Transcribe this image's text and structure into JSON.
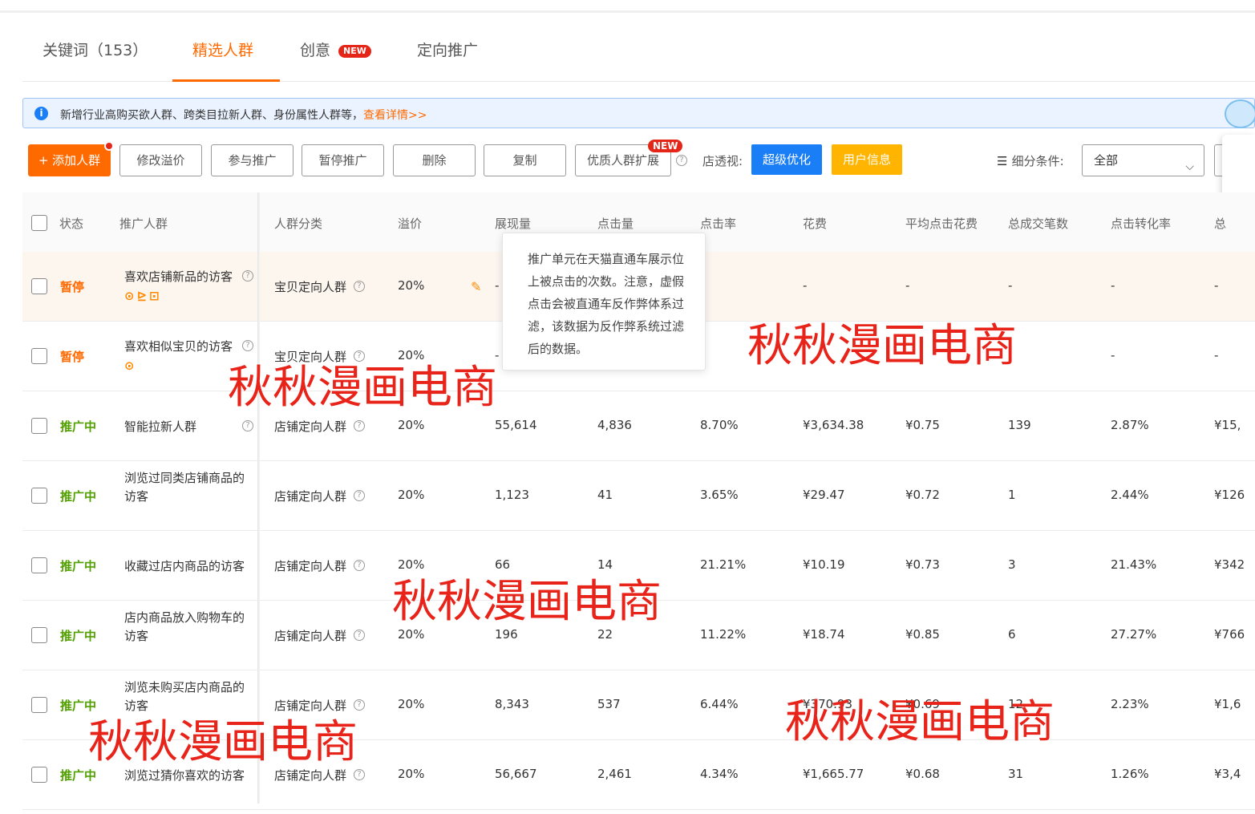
{
  "tabs": [
    {
      "label": "关键词（153）",
      "active": false
    },
    {
      "label": "精选人群",
      "active": true
    },
    {
      "label": "创意",
      "badge": "NEW",
      "active": false
    },
    {
      "label": "定向推广",
      "active": false
    }
  ],
  "notice": {
    "text": "新增行业高购买欲人群、跨类目拉新人群、身份属性人群等，",
    "link": "查看详情>>"
  },
  "toolbar": {
    "add": "+ 添加人群",
    "modify_premium": "修改溢价",
    "join": "参与推广",
    "pause": "暂停推广",
    "delete": "删除",
    "copy": "复制",
    "quality_expand": "优质人群扩展",
    "quality_badge": "NEW",
    "shop_view_label": "店透视:",
    "super_optimize": "超级优化",
    "user_info": "用户信息",
    "filter_label": "细分条件:",
    "filter_value": "全部"
  },
  "table": {
    "headers": [
      "状态",
      "推广人群",
      "人群分类",
      "溢价",
      "展现量",
      "点击量",
      "点击率",
      "花费",
      "平均点击花费",
      "总成交笔数",
      "点击转化率",
      "总"
    ],
    "rows": [
      {
        "status": "暂停",
        "status_type": "paused",
        "name1": "喜欢店铺新品的访客",
        "name2": "",
        "help": true,
        "icons": "⊙⊵⊡",
        "category": "宝贝定向人群",
        "premium": "20%",
        "impressions": "-",
        "clicks": "",
        "ctr": "",
        "cost": "-",
        "cpc": "-",
        "orders": "-",
        "cvr": "-",
        "total": "-"
      },
      {
        "status": "暂停",
        "status_type": "paused",
        "name1": "喜欢相似宝贝的访客",
        "name2": "",
        "help": true,
        "icons": "⊙",
        "category": "宝贝定向人群",
        "premium": "20%",
        "impressions": "-",
        "clicks": "",
        "ctr": "",
        "cost": "",
        "cpc": "",
        "orders": "",
        "cvr": "-",
        "total": "-"
      },
      {
        "status": "推广中",
        "status_type": "active",
        "name1": "智能拉新人群",
        "name2": "",
        "help": true,
        "icons": "",
        "category": "店铺定向人群",
        "premium": "20%",
        "impressions": "55,614",
        "clicks": "4,836",
        "ctr": "8.70%",
        "cost": "¥3,634.38",
        "cpc": "¥0.75",
        "orders": "139",
        "cvr": "2.87%",
        "total": "¥15,"
      },
      {
        "status": "推广中",
        "status_type": "active",
        "name1": "浏览过同类店铺商品的",
        "name2": "访客",
        "help": false,
        "icons": "",
        "category": "店铺定向人群",
        "premium": "20%",
        "impressions": "1,123",
        "clicks": "41",
        "ctr": "3.65%",
        "cost": "¥29.47",
        "cpc": "¥0.72",
        "orders": "1",
        "cvr": "2.44%",
        "total": "¥126"
      },
      {
        "status": "推广中",
        "status_type": "active",
        "name1": "收藏过店内商品的访客",
        "name2": "",
        "help": false,
        "icons": "",
        "category": "店铺定向人群",
        "premium": "20%",
        "impressions": "66",
        "clicks": "14",
        "ctr": "21.21%",
        "cost": "¥10.19",
        "cpc": "¥0.73",
        "orders": "3",
        "cvr": "21.43%",
        "total": "¥342"
      },
      {
        "status": "推广中",
        "status_type": "active",
        "name1": "店内商品放入购物车的",
        "name2": "访客",
        "help": false,
        "icons": "",
        "category": "店铺定向人群",
        "premium": "20%",
        "impressions": "196",
        "clicks": "22",
        "ctr": "11.22%",
        "cost": "¥18.74",
        "cpc": "¥0.85",
        "orders": "6",
        "cvr": "27.27%",
        "total": "¥766"
      },
      {
        "status": "推广中",
        "status_type": "active",
        "name1": "浏览未购买店内商品的",
        "name2": "访客",
        "help": false,
        "icons": "",
        "category": "店铺定向人群",
        "premium": "20%",
        "impressions": "8,343",
        "clicks": "537",
        "ctr": "6.44%",
        "cost": "¥370.93",
        "cpc": "¥0.69",
        "orders": "12",
        "cvr": "2.23%",
        "total": "¥1,6"
      },
      {
        "status": "推广中",
        "status_type": "active",
        "name1": "浏览过猜你喜欢的访客",
        "name2": "",
        "help": false,
        "icons": "",
        "category": "店铺定向人群",
        "premium": "20%",
        "impressions": "56,667",
        "clicks": "2,461",
        "ctr": "4.34%",
        "cost": "¥1,665.77",
        "cpc": "¥0.68",
        "orders": "31",
        "cvr": "1.26%",
        "total": "¥3,4"
      }
    ]
  },
  "tooltip": {
    "lines": [
      "推广单元在天猫直通车展示位",
      "上被点击的次数。注意，虚假",
      "点击会被直通车反作弊体系过",
      "滤，该数据为反作弊系统过滤",
      "后的数据。"
    ]
  },
  "watermark": "秋秋漫画电商",
  "colors": {
    "accent": "#ff6a00",
    "active_green": "#52a000",
    "watermark_red": "#e8241a",
    "blue": "#1a7ff7",
    "yellow": "#ffb400"
  }
}
